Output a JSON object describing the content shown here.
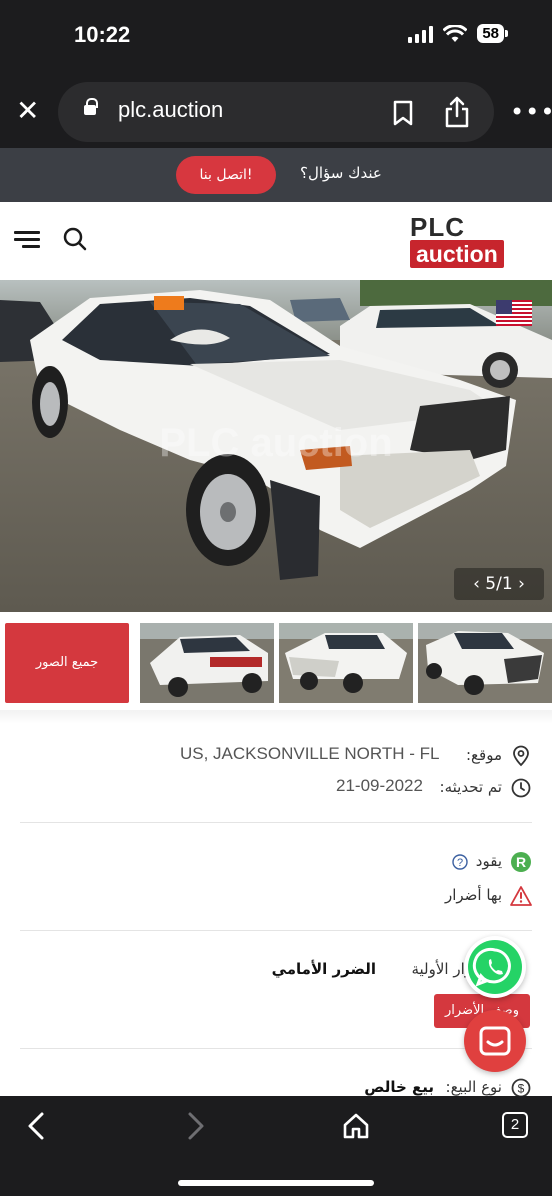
{
  "status_bar": {
    "time": "10:22",
    "battery": "58"
  },
  "browser": {
    "url": "plc.auction",
    "tab_count": "2"
  },
  "contact_bar": {
    "question": "عندك سؤال؟",
    "button": "اتصل بنا!"
  },
  "logo": {
    "line1": "PLC",
    "line2": "auction"
  },
  "photo": {
    "pager": "‹ 5/1 ›",
    "watermark": "PLC auction"
  },
  "gallery": {
    "all_photos": "جميع الصور"
  },
  "details": {
    "location_label": "موقع:",
    "location_value": "US, JACKSONVILLE NORTH - FL",
    "updated_label": "تم تحديثه:",
    "updated_value": "21-09-2022",
    "drives_label": "يقود",
    "damage_label": "بها أضرار",
    "primary_damage_label": "رار الأولية",
    "primary_damage_value": "الضرر الأمامي",
    "damage_button": "وصف الأضرار",
    "sale_type_label": "نوع البيع:",
    "sale_type_value": "بيع خالص"
  },
  "colors": {
    "accent": "#d4383e",
    "dark": "#1c1c1e",
    "whatsapp": "#25d366"
  }
}
